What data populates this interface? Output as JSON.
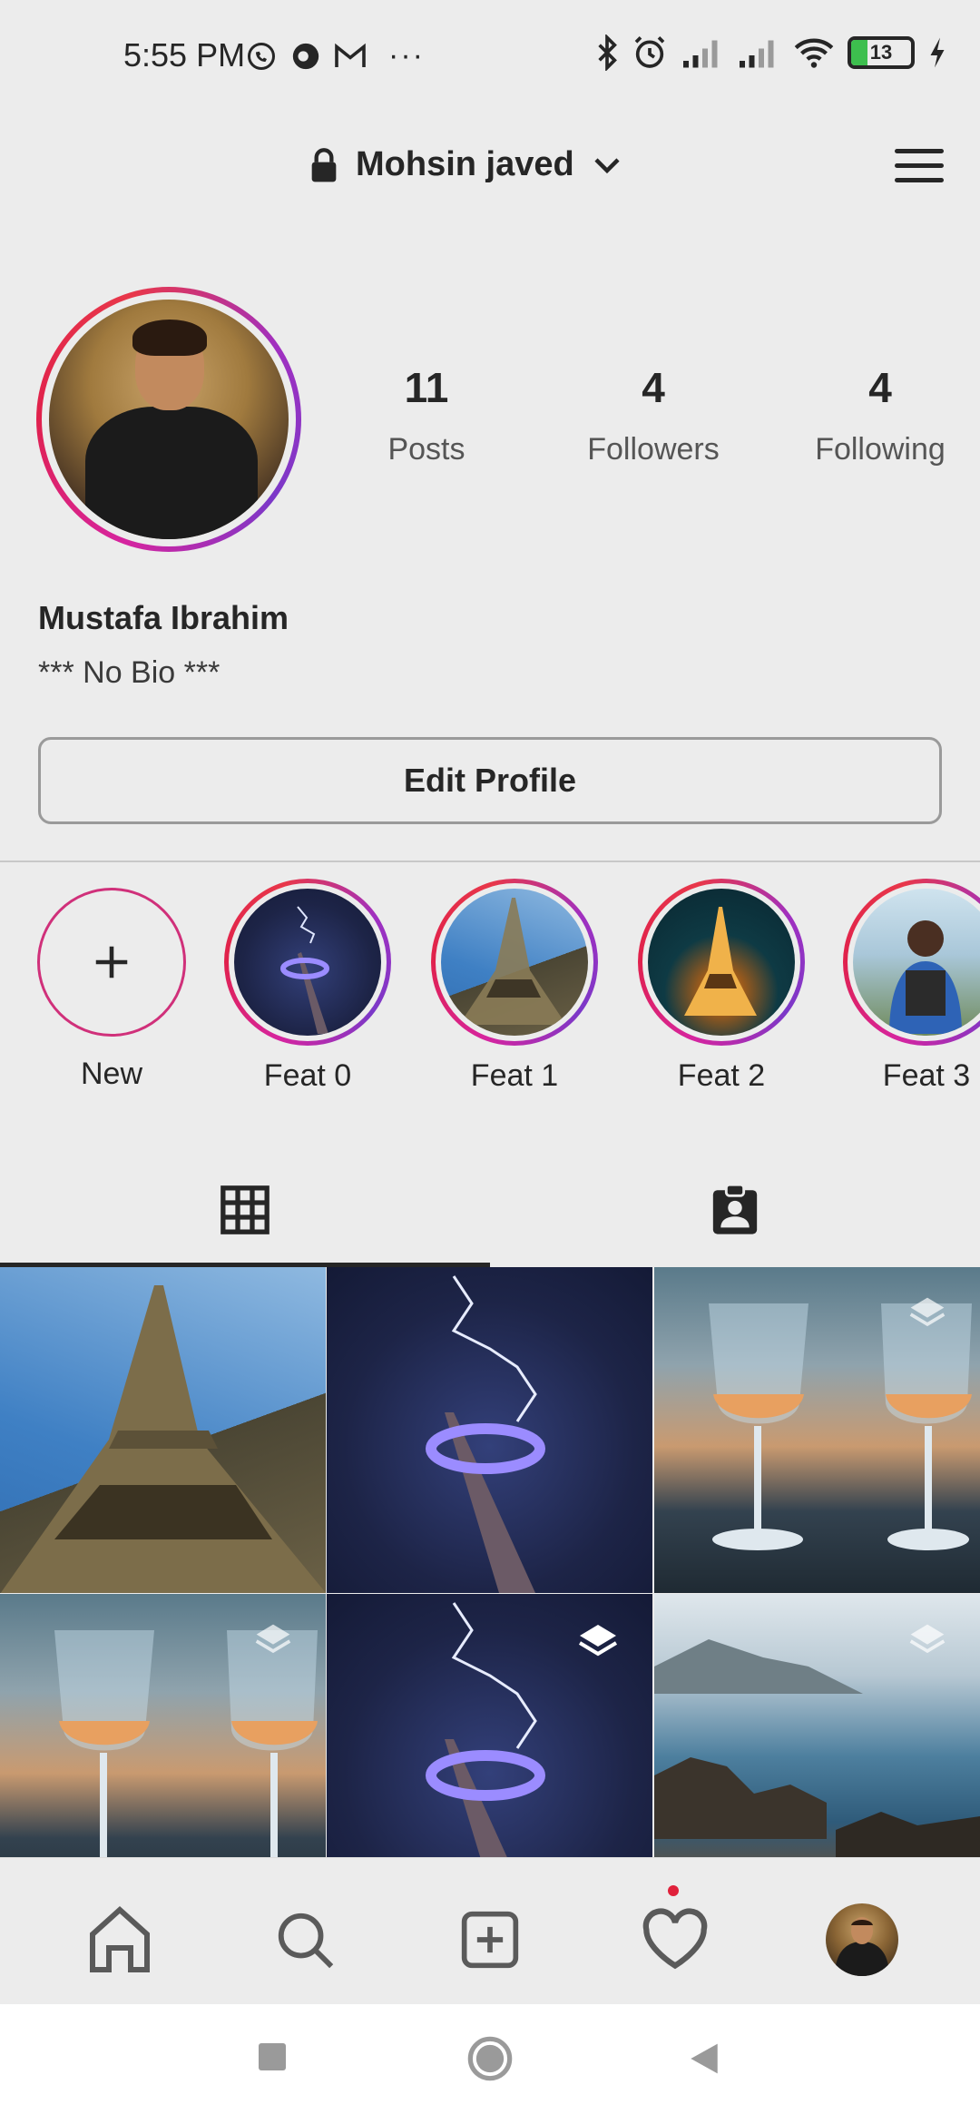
{
  "status_bar": {
    "time": "5:55 PM",
    "more": "···",
    "battery": "13"
  },
  "header": {
    "username": "Mohsin javed"
  },
  "profile": {
    "stats": [
      {
        "value": "11",
        "label": "Posts"
      },
      {
        "value": "4",
        "label": "Followers"
      },
      {
        "value": "4",
        "label": "Following"
      }
    ],
    "display_name": "Mustafa Ibrahim",
    "bio": "*** No Bio ***",
    "edit_label": "Edit Profile"
  },
  "highlights": {
    "new_label": "New",
    "items": [
      {
        "label": "Feat 0"
      },
      {
        "label": "Feat 1"
      },
      {
        "label": "Feat 2"
      },
      {
        "label": "Feat 3"
      }
    ]
  },
  "tabs": [
    {
      "icon": "grid-icon"
    },
    {
      "icon": "tagged-icon"
    }
  ],
  "colors": {
    "background": "#ececec",
    "text": "#262626",
    "story_ring_start": "#d6249f",
    "story_ring_end": "#e0214b",
    "notification": "#e0213b"
  }
}
